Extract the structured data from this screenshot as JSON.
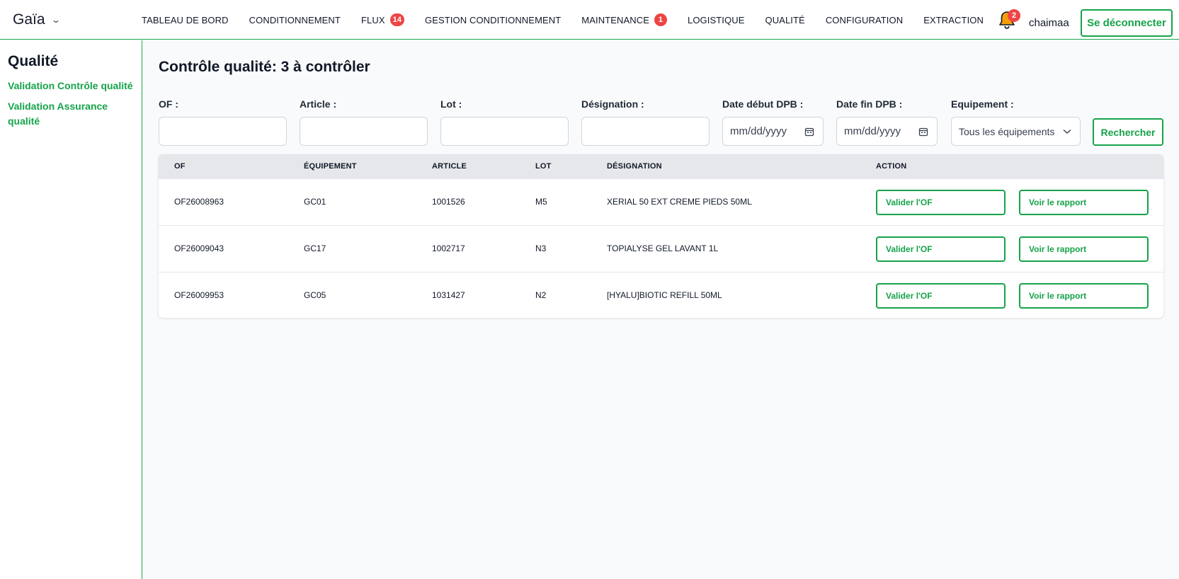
{
  "brand": {
    "name": "Gaïa"
  },
  "nav": {
    "items": [
      {
        "label": "TABLEAU DE BORD",
        "badge": ""
      },
      {
        "label": "CONDITIONNEMENT",
        "badge": ""
      },
      {
        "label": "FLUX",
        "badge": "14"
      },
      {
        "label": "GESTION CONDITIONNEMENT",
        "badge": ""
      },
      {
        "label": "MAINTENANCE",
        "badge": "1"
      },
      {
        "label": "LOGISTIQUE",
        "badge": ""
      },
      {
        "label": "QUALITÉ",
        "badge": ""
      },
      {
        "label": "CONFIGURATION",
        "badge": ""
      },
      {
        "label": "EXTRACTION",
        "badge": ""
      }
    ]
  },
  "user": {
    "notifications": "2",
    "name": "chaimaa",
    "logout_label": "Se déconnecter"
  },
  "sidebar": {
    "title": "Qualité",
    "links": [
      {
        "label": "Validation Contrôle qualité"
      },
      {
        "label": "Validation Assurance qualité"
      }
    ]
  },
  "page": {
    "title": "Contrôle qualité: 3 à contrôler"
  },
  "filters": {
    "of_label": "OF :",
    "article_label": "Article :",
    "lot_label": "Lot :",
    "designation_label": "Désignation :",
    "date_start_label": "Date début DPB :",
    "date_start_placeholder": "mm/dd/yyyy",
    "date_end_label": "Date fin DPB :",
    "date_end_placeholder": "mm/dd/yyyy",
    "equipment_label": "Equipement :",
    "equipment_selected": "Tous les équipements",
    "search_label": "Rechercher"
  },
  "table": {
    "headers": [
      "OF",
      "ÉQUIPEMENT",
      "ARTICLE",
      "LOT",
      "DÉSIGNATION",
      "ACTION"
    ],
    "rows": [
      {
        "of": "OF26008963",
        "equipement": "GC01",
        "article": "1001526",
        "lot": "M5",
        "designation": "XERIAL 50 EXT CREME PIEDS 50ML",
        "validate_label": "Valider l'OF",
        "report_label": "Voir le rapport"
      },
      {
        "of": "OF26009043",
        "equipement": "GC17",
        "article": "1002717",
        "lot": "N3",
        "designation": "TOPIALYSE GEL LAVANT 1L",
        "validate_label": "Valider l'OF",
        "report_label": "Voir le rapport"
      },
      {
        "of": "OF26009953",
        "equipement": "GC05",
        "article": "1031427",
        "lot": "N2",
        "designation": "[HYALU]BIOTIC REFILL 50ML",
        "validate_label": "Valider l'OF",
        "report_label": "Voir le rapport"
      }
    ]
  },
  "colors": {
    "accent": "#16a34a",
    "badge": "#ef4444",
    "bell": "#f59e0b"
  }
}
